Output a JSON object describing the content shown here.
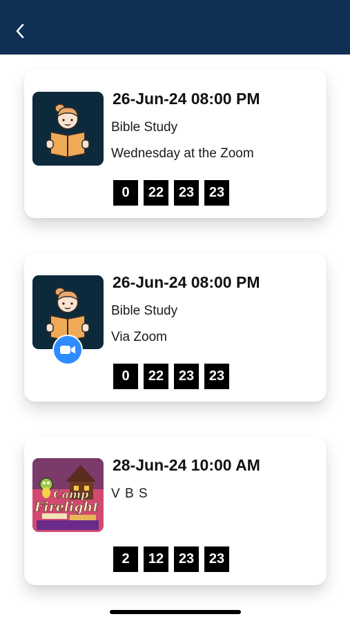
{
  "header": {
    "back_icon": "chevron-left-icon",
    "background": "#0f2f55"
  },
  "events": [
    {
      "datetime": "26-Jun-24 08:00 PM",
      "name": "Bible Study",
      "location": "Wednesday at the Zoom",
      "image": "girl-reading-book",
      "countdown": [
        "0",
        "22",
        "23",
        "23"
      ]
    },
    {
      "datetime": "26-Jun-24 08:00 PM",
      "name": "Bible Study",
      "location": "Via Zoom",
      "image": "girl-reading-book",
      "badge_icon": "zoom-video-icon",
      "countdown": [
        "0",
        "22",
        "23",
        "23"
      ]
    },
    {
      "datetime": "28-Jun-24 10:00 AM",
      "name": "V B S",
      "location": "",
      "image": "camp-firelight-logo",
      "image_text": "Camp Firelight",
      "countdown": [
        "2",
        "12",
        "23",
        "23"
      ]
    }
  ],
  "colors": {
    "countdown_bg": "#000000",
    "zoom_blue": "#2d8cff"
  }
}
